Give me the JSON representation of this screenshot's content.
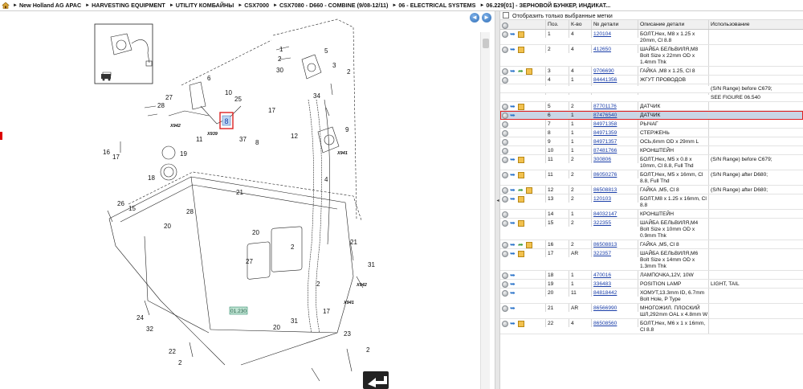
{
  "breadcrumb": [
    "New Holland AG APAC",
    "HARVESTING EQUIPMENT",
    "UTILITY КОМБАЙНЫ",
    "CSX7000",
    "CSX7080 - D660 - COMBINE (9/08-12/11)",
    "06 - ELECTRICAL SYSTEMS",
    "06.229[01] - ЗЕРНОВОЙ БУНКЕР, ИНДИКАТ..."
  ],
  "nav": {
    "back": "◄",
    "forward": "►"
  },
  "diagram": {
    "callouts": [
      "1",
      "2",
      "5",
      "30",
      "3",
      "2",
      "6",
      "10",
      "25",
      "27",
      "28",
      "17",
      "34",
      "X942",
      "X939",
      "37",
      "8",
      "11",
      "9",
      "12",
      "X941",
      "16",
      "17",
      "4",
      "18",
      "19",
      "21",
      "26",
      "15",
      "20",
      "28",
      "20",
      "2",
      "21",
      "27",
      "X942",
      "2",
      "31",
      "X941",
      "17",
      "24",
      "32",
      "20",
      "31",
      "23",
      "22",
      "2",
      "2"
    ],
    "highlight_label": "8",
    "tag_label": "01.230"
  },
  "filter": {
    "label": "Отобразить только выбранные метки"
  },
  "table": {
    "headers": [
      "Поз.",
      "К-во",
      "№ детали",
      "Описание детали",
      "Использование"
    ],
    "rows": [
      {
        "icons": [
          "dot",
          "info",
          "cube"
        ],
        "pos": "1",
        "qty": "4",
        "part": "120104",
        "desc": "БОЛТ,Hex, M8 x 1.25 x 20mm, Cl 8.8",
        "use": ""
      },
      {
        "icons": [
          "dot",
          "info",
          "cube"
        ],
        "pos": "2",
        "qty": "4",
        "part": "412650",
        "desc": "ШАЙБА БЕЛЬВИЛЯ,M8 Bolt Size x 22mm OD x 1.4mm Thk",
        "use": ""
      },
      {
        "icons": [
          "dot",
          "info",
          "leaf",
          "cube"
        ],
        "pos": "3",
        "qty": "4",
        "part": "9706690",
        "desc": "ГАЙКА ,M8 x 1.25, Cl 8",
        "use": ""
      },
      {
        "icons": [
          "dot"
        ],
        "pos": "4",
        "qty": "1",
        "part": "84441356",
        "desc": "ЖГУТ ПРОВОДОВ",
        "use": ""
      },
      {
        "icons": [],
        "pos": "",
        "qty": "",
        "part": "",
        "desc": "",
        "use": "(S/N Range) before C679;"
      },
      {
        "icons": [],
        "pos": "",
        "qty": "",
        "part": "",
        "desc": "",
        "use": "SEE FIGURE 06.540"
      },
      {
        "icons": [
          "dot",
          "info",
          "cube"
        ],
        "pos": "5",
        "qty": "2",
        "part": "87701176",
        "desc": "ДАТЧИК",
        "use": ""
      },
      {
        "icons": [
          "dot",
          "info"
        ],
        "pos": "6",
        "qty": "1",
        "part": "87476540",
        "desc": "ДАТЧИК",
        "use": "",
        "selected": true
      },
      {
        "icons": [
          "dot"
        ],
        "pos": "7",
        "qty": "1",
        "part": "84971358",
        "desc": "РЫЧАГ",
        "use": ""
      },
      {
        "icons": [
          "dot"
        ],
        "pos": "8",
        "qty": "1",
        "part": "84971359",
        "desc": "СТЕРЖЕНЬ",
        "use": ""
      },
      {
        "icons": [
          "dot"
        ],
        "pos": "9",
        "qty": "1",
        "part": "84971357",
        "desc": "ОСЬ,6mm OD x 29mm L",
        "use": ""
      },
      {
        "icons": [
          "dot"
        ],
        "pos": "10",
        "qty": "1",
        "part": "87481766",
        "desc": "КРОНШТЕЙН",
        "use": ""
      },
      {
        "icons": [
          "dot",
          "info",
          "cube"
        ],
        "pos": "11",
        "qty": "2",
        "part": "300806",
        "desc": "БОЛТ,Hex, M5 x 0.8 x 10mm, Cl 8.8, Full Thd",
        "use": "(S/N Range) before C679;"
      },
      {
        "icons": [
          "dot",
          "info",
          "cube"
        ],
        "pos": "11",
        "qty": "2",
        "part": "86050276",
        "desc": "БОЛТ,Hex, M5 x 16mm, Cl 8.8, Full Thd",
        "use": "(S/N Range) after D680;"
      },
      {
        "icons": [
          "dot",
          "info",
          "leaf",
          "cube"
        ],
        "pos": "12",
        "qty": "2",
        "part": "86508813",
        "desc": "ГАЙКА ,M5, Cl 8",
        "use": "(S/N Range) after D680;"
      },
      {
        "icons": [
          "dot",
          "info",
          "cube"
        ],
        "pos": "13",
        "qty": "2",
        "part": "120103",
        "desc": "БОЛТ,M8 x 1.25 x 16mm, Cl 8.8",
        "use": ""
      },
      {
        "icons": [
          "dot"
        ],
        "pos": "14",
        "qty": "1",
        "part": "84032147",
        "desc": "КРОНШТЕЙН",
        "use": ""
      },
      {
        "icons": [
          "dot",
          "info",
          "cube"
        ],
        "pos": "15",
        "qty": "2",
        "part": "322355",
        "desc": "ШАЙБА БЕЛЬВИЛЯ,M4 Bolt Size x 10mm OD x 0.9mm Thk",
        "use": ""
      },
      {
        "icons": [
          "dot",
          "info",
          "leaf",
          "cube"
        ],
        "pos": "16",
        "qty": "2",
        "part": "86508813",
        "desc": "ГАЙКА ,M5, Cl 8",
        "use": ""
      },
      {
        "icons": [
          "dot",
          "info",
          "cube"
        ],
        "pos": "17",
        "qty": "AR",
        "part": "322357",
        "desc": "ШАЙБА БЕЛЬВИЛЯ,M6 Bolt Size x 14mm OD x 1.3mm Thk",
        "use": ""
      },
      {
        "icons": [
          "dot",
          "info"
        ],
        "pos": "18",
        "qty": "1",
        "part": "470016",
        "desc": "ЛАМПОЧКА,12V, 10W",
        "use": ""
      },
      {
        "icons": [
          "dot",
          "info"
        ],
        "pos": "19",
        "qty": "1",
        "part": "336483",
        "desc": "POSITION LAMP",
        "use": "LIGHT, TAIL"
      },
      {
        "icons": [
          "dot",
          "info"
        ],
        "pos": "20",
        "qty": "11",
        "part": "84818442",
        "desc": "ХОМУТ,13.3mm ID, 6.7mm Bolt Hole, P Type",
        "use": ""
      },
      {
        "icons": [
          "dot",
          "info"
        ],
        "pos": "21",
        "qty": "AR",
        "part": "86566990",
        "desc": "МНОГОЖИЛ. ПЛОСКИЙ ШЛ,292mm OAL x 4.8mm W",
        "use": ""
      },
      {
        "icons": [
          "dot",
          "info",
          "cube"
        ],
        "pos": "22",
        "qty": "4",
        "part": "86508560",
        "desc": "БОЛТ,Hex, M6 x 1 x 16mm, Cl 8.8",
        "use": ""
      }
    ]
  }
}
